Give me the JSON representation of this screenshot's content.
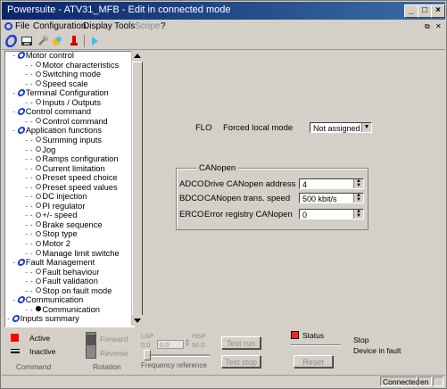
{
  "window": {
    "title": "Powersuite - ATV31_MFB - Edit in connected mode"
  },
  "menu": {
    "items": [
      "File",
      "Configuration",
      "Display",
      "Tools",
      "Scope",
      "?"
    ]
  },
  "tree": {
    "items": [
      {
        "level": 1,
        "type": "cat",
        "label": "Motor control"
      },
      {
        "level": 2,
        "type": "leaf",
        "label": "Motor characteristics"
      },
      {
        "level": 2,
        "type": "leaf",
        "label": "Switching mode"
      },
      {
        "level": 2,
        "type": "leaf",
        "label": "Speed scale"
      },
      {
        "level": 1,
        "type": "cat",
        "label": "Terminal Configuration"
      },
      {
        "level": 2,
        "type": "leaf",
        "label": "Inputs / Outputs"
      },
      {
        "level": 1,
        "type": "cat",
        "label": "Control command"
      },
      {
        "level": 2,
        "type": "leaf",
        "label": "Control command"
      },
      {
        "level": 1,
        "type": "cat",
        "label": "Application functions"
      },
      {
        "level": 2,
        "type": "leaf",
        "label": "Summing inputs"
      },
      {
        "level": 2,
        "type": "leaf",
        "label": "Jog"
      },
      {
        "level": 2,
        "type": "leaf",
        "label": "Ramps configuration"
      },
      {
        "level": 2,
        "type": "leaf",
        "label": "Current limitation"
      },
      {
        "level": 2,
        "type": "leaf",
        "label": "Preset speed choice"
      },
      {
        "level": 2,
        "type": "leaf",
        "label": "Preset speed values"
      },
      {
        "level": 2,
        "type": "leaf",
        "label": "DC injection"
      },
      {
        "level": 2,
        "type": "leaf",
        "label": "PI regulator"
      },
      {
        "level": 2,
        "type": "leaf",
        "label": "+/- speed"
      },
      {
        "level": 2,
        "type": "leaf",
        "label": "Brake sequence"
      },
      {
        "level": 2,
        "type": "leaf",
        "label": "Stop type"
      },
      {
        "level": 2,
        "type": "leaf",
        "label": "Motor 2"
      },
      {
        "level": 2,
        "type": "leaf",
        "label": "Manage limit switche"
      },
      {
        "level": 1,
        "type": "cat",
        "label": "Fault Management"
      },
      {
        "level": 2,
        "type": "leaf",
        "label": "Fault behaviour"
      },
      {
        "level": 2,
        "type": "leaf",
        "label": "Fault validation"
      },
      {
        "level": 2,
        "type": "leaf",
        "label": "Stop on fault mode"
      },
      {
        "level": 1,
        "type": "cat",
        "label": "Communication"
      },
      {
        "level": 2,
        "type": "sel",
        "label": "Communication"
      },
      {
        "level": 0,
        "type": "cat",
        "label": "Inputs summary"
      }
    ]
  },
  "main": {
    "flo": {
      "code": "FLO",
      "label": "Forced local mode",
      "value": "Not assigned"
    },
    "canopen": {
      "title": "CANopen",
      "rows": [
        {
          "code": "ADCO",
          "label": "Drive CANopen address",
          "value": "4"
        },
        {
          "code": "BDCO",
          "label": "CANopen trans. speed",
          "value": "500 kbit/s"
        },
        {
          "code": "ERCO",
          "label": "Error registry CANopen",
          "value": "0"
        }
      ]
    }
  },
  "bottom": {
    "command": {
      "active": "Active",
      "inactive": "Inactive",
      "caption": "Command"
    },
    "rotation": {
      "forward": "Forward",
      "reverse": "Reverse",
      "caption": "Rotation"
    },
    "frequency": {
      "lsp": "LSP",
      "hsp": "HSP",
      "lsp_val": "0.0",
      "current": "0.0",
      "hsp_val": "50.0",
      "caption": "Frequency reference"
    },
    "test_run": "Test run",
    "test_stop": "Test stop",
    "status_label": "Status",
    "reset": "Reset",
    "drive_state": "Stop",
    "fault_text": "Device in fault"
  },
  "statusbar": {
    "connection": "Connected",
    "language": "en"
  },
  "colors": {
    "title_start": "#0a246a",
    "title_end": "#3a6ea5",
    "active_red": "#ff0000",
    "status_red": "#ff2020",
    "icon_blue": "#1d3fd0"
  }
}
